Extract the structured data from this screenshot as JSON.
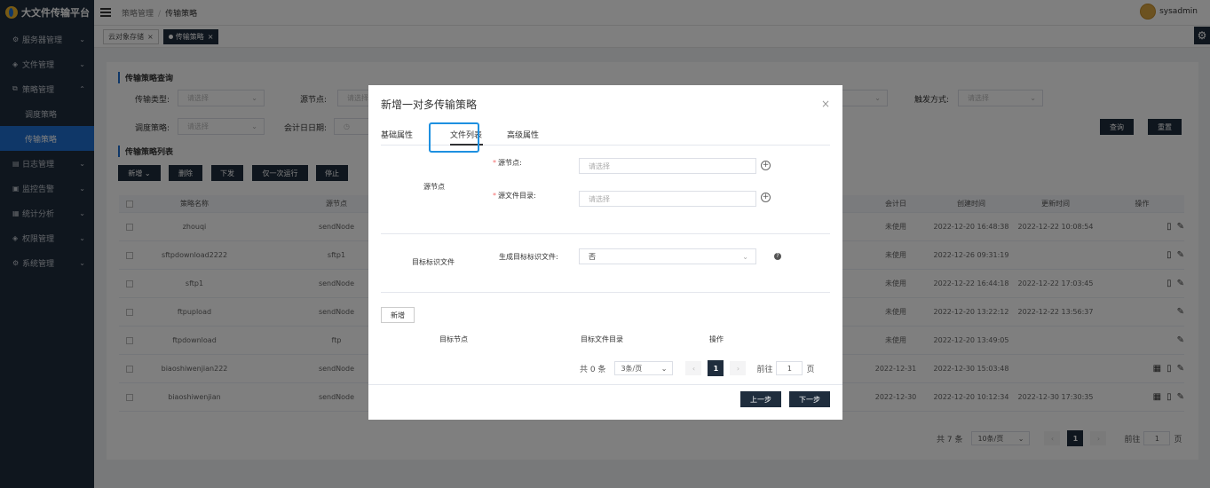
{
  "app": {
    "title": "大文件传输平台"
  },
  "sidebar": {
    "items": [
      {
        "label": "服务器管理",
        "icon": "server-icon",
        "chevron": "⌄"
      },
      {
        "label": "文件管理",
        "icon": "layers-icon",
        "chevron": "⌄"
      },
      {
        "label": "策略管理",
        "icon": "strategy-icon",
        "chevron": "⌃"
      },
      {
        "label": "日志管理",
        "icon": "log-icon",
        "chevron": "⌄"
      },
      {
        "label": "监控告警",
        "icon": "monitor-icon",
        "chevron": "⌄"
      },
      {
        "label": "统计分析",
        "icon": "chart-icon",
        "chevron": "⌄"
      },
      {
        "label": "权限管理",
        "icon": "layers-icon",
        "chevron": "⌄"
      },
      {
        "label": "系统管理",
        "icon": "settings-icon",
        "chevron": "⌄"
      }
    ],
    "sub_items": [
      {
        "label": "调度策略"
      },
      {
        "label": "传输策略"
      }
    ]
  },
  "header": {
    "breadcrumb": [
      "策略管理",
      "传输策略"
    ],
    "breadcrumb_sep": "/",
    "user": "sysadmin"
  },
  "tags": [
    {
      "label": "云对象存储",
      "close": "×"
    },
    {
      "label": "传输策略",
      "close": "×"
    }
  ],
  "query": {
    "title": "传输策略查询",
    "type_label": "传输类型:",
    "src_label": "源节点:",
    "trigger_label": "触发方式:",
    "dispatch_label": "调度策略:",
    "calendar_label": "会计日日期:",
    "placeholder": "请选择",
    "search_button": "查询",
    "reset_button": "重置"
  },
  "list": {
    "title": "传输策略列表",
    "buttons": [
      "新增",
      "删除",
      "下发",
      "仅一次运行",
      "停止"
    ],
    "add_chevron": "⌄",
    "columns": [
      "策略名称",
      "源节点",
      "会计日",
      "创建时间",
      "更新时间",
      "操作"
    ],
    "rows": [
      {
        "name": "zhouqi",
        "src": "sendNode",
        "cal": "未使用",
        "created": "2022-12-20 16:48:38",
        "updated": "2022-12-22 10:08:54",
        "ops": [
          "doc-icon",
          "edit-icon"
        ]
      },
      {
        "name": "sftpdownload2222",
        "src": "sftp1",
        "cal": "未使用",
        "created": "2022-12-26 09:31:19",
        "updated": "",
        "ops": [
          "doc-icon",
          "edit-icon"
        ]
      },
      {
        "name": "sftp1",
        "src": "sendNode",
        "cal": "未使用",
        "created": "2022-12-22 16:44:18",
        "updated": "2022-12-22 17:03:45",
        "ops": [
          "doc-icon",
          "edit-icon"
        ]
      },
      {
        "name": "ftpupload",
        "src": "sendNode",
        "cal": "未使用",
        "created": "2022-12-20 13:22:12",
        "updated": "2022-12-22 13:56:37",
        "ops": [
          "edit-icon"
        ]
      },
      {
        "name": "ftpdownload",
        "src": "ftp",
        "cal": "未使用",
        "created": "2022-12-20 13:49:05",
        "updated": "",
        "ops": [
          "edit-icon"
        ]
      },
      {
        "name": "biaoshiwenjian222",
        "src": "sendNode",
        "cal": "2022-12-31",
        "created": "2022-12-30 15:03:48",
        "updated": "",
        "ops": [
          "calendar-icon",
          "doc-icon",
          "edit-icon"
        ]
      },
      {
        "name": "biaoshiwenjian",
        "src": "sendNode",
        "cal": "2022-12-30",
        "created": "2022-12-20 10:12:34",
        "updated": "2022-12-30 17:30:35",
        "ops": [
          "calendar-icon",
          "doc-icon",
          "edit-icon"
        ]
      }
    ],
    "pager": {
      "total": "共 7 条",
      "size": "10条/页",
      "page": "1",
      "goto": "前往",
      "goto_value": "1",
      "unit": "页",
      "prev": "‹",
      "next": "›"
    }
  },
  "modal": {
    "title": "新增一对多传输策略",
    "close": "×",
    "tabs": [
      "基础属性",
      "文件列表",
      "高级属性"
    ],
    "active_tab": 1,
    "src_group": "源节点",
    "src_node_label": "源节点:",
    "src_dir_label": "源文件目录:",
    "required_mark": "*",
    "placeholder": "请选择",
    "plus": "+",
    "target_group": "目标标识文件",
    "gen_label": "生成目标标识文件:",
    "gen_value": "否",
    "help": "?",
    "add_button": "新增",
    "table_headers": [
      "目标节点",
      "目标文件目录",
      "操作"
    ],
    "pager": {
      "total": "共 0 条",
      "size": "3条/页",
      "page": "1",
      "goto": "前往",
      "goto_value": "1",
      "unit": "页",
      "prev": "‹",
      "next": "›"
    },
    "prev_button": "上一步",
    "next_button": "下一步"
  },
  "colors": {
    "sidebar": "#1f2d3d",
    "accent": "#1f6fd0",
    "focus": "#1e90e0"
  }
}
